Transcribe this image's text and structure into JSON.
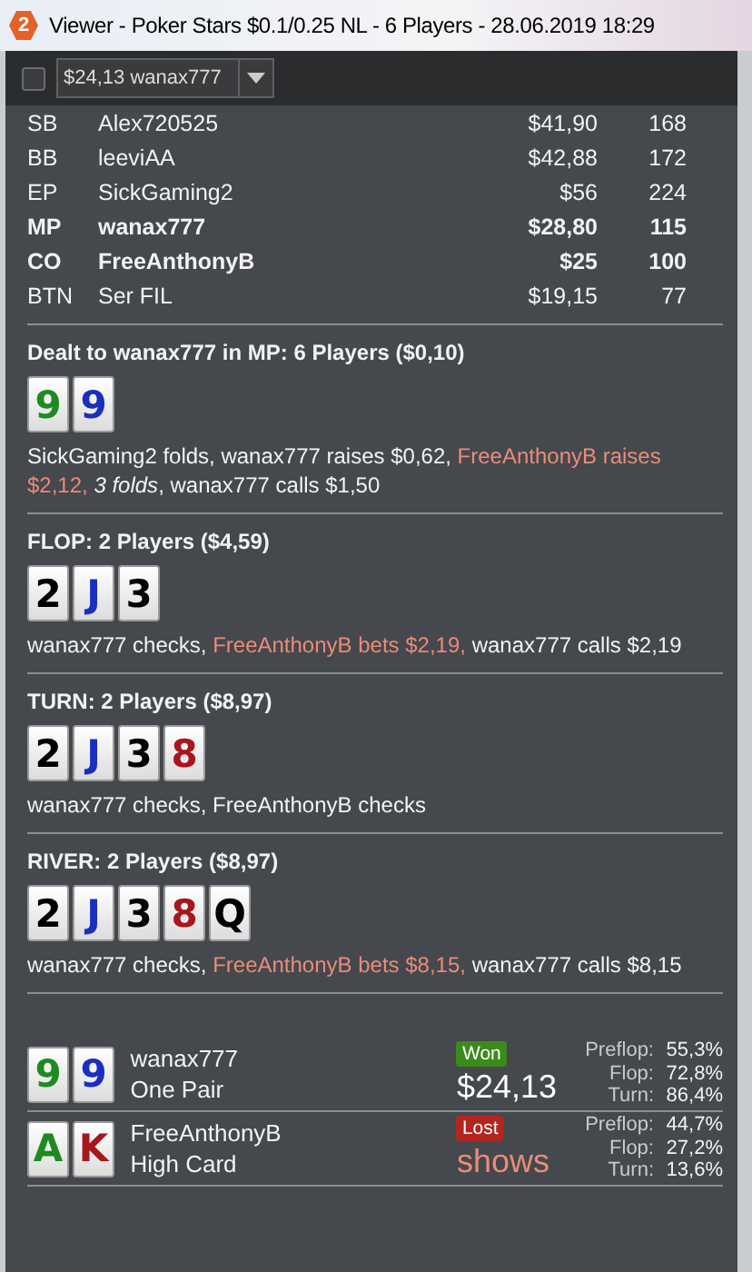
{
  "window": {
    "badge": "2",
    "title": "Viewer - Poker Stars $0.1/0.25 NL - 6 Players - 28.06.2019 18:29"
  },
  "toolbar": {
    "checked": false,
    "hand_select": "$24,13 wanax777"
  },
  "players": [
    {
      "position": "SB",
      "name": "Alex720525",
      "stack": "$41,90",
      "bb": "168",
      "highlight": false
    },
    {
      "position": "BB",
      "name": "leeviAA",
      "stack": "$42,88",
      "bb": "172",
      "highlight": false
    },
    {
      "position": "EP",
      "name": "SickGaming2",
      "stack": "$56",
      "bb": "224",
      "highlight": false
    },
    {
      "position": "MP",
      "name": "wanax777",
      "stack": "$28,80",
      "bb": "115",
      "highlight": true
    },
    {
      "position": "CO",
      "name": "FreeAnthonyB",
      "stack": "$25",
      "bb": "100",
      "highlight": true
    },
    {
      "position": "BTN",
      "name": "Ser FIL",
      "stack": "$19,15",
      "bb": "77",
      "highlight": false
    }
  ],
  "streets": [
    {
      "heading": "Dealt to wanax777 in MP: 6 Players ($0,10)",
      "cards": [
        {
          "rank": "9",
          "color": "#1f8a1f"
        },
        {
          "rank": "9",
          "color": "#1a2fc0"
        }
      ],
      "actions": [
        {
          "kind": "plain",
          "text": "SickGaming2 folds, wanax777 raises $0,62, "
        },
        {
          "kind": "villain",
          "text": "FreeAnthonyB raises $2,12, "
        },
        {
          "kind": "folds",
          "text": "3 folds"
        },
        {
          "kind": "plain",
          "text": ", wanax777 calls $1,50"
        }
      ]
    },
    {
      "heading": "FLOP: 2 Players ($4,59)",
      "cards": [
        {
          "rank": "2",
          "color": "#000000"
        },
        {
          "rank": "J",
          "color": "#1a2fc0"
        },
        {
          "rank": "3",
          "color": "#000000"
        }
      ],
      "actions": [
        {
          "kind": "plain",
          "text": "wanax777 checks, "
        },
        {
          "kind": "villain",
          "text": "FreeAnthonyB bets $2,19,"
        },
        {
          "kind": "plain",
          "text": " wanax777 calls $2,19"
        }
      ]
    },
    {
      "heading": "TURN: 2 Players ($8,97)",
      "cards": [
        {
          "rank": "2",
          "color": "#000000"
        },
        {
          "rank": "J",
          "color": "#1a2fc0"
        },
        {
          "rank": "3",
          "color": "#000000"
        },
        {
          "rank": "8",
          "color": "#a8161c"
        }
      ],
      "actions": [
        {
          "kind": "plain",
          "text": "wanax777 checks, FreeAnthonyB checks"
        }
      ]
    },
    {
      "heading": "RIVER: 2 Players ($8,97)",
      "cards": [
        {
          "rank": "2",
          "color": "#000000"
        },
        {
          "rank": "J",
          "color": "#1a2fc0"
        },
        {
          "rank": "3",
          "color": "#000000"
        },
        {
          "rank": "8",
          "color": "#a8161c"
        },
        {
          "rank": "Q",
          "color": "#000000"
        }
      ],
      "actions": [
        {
          "kind": "plain",
          "text": "wanax777 checks, "
        },
        {
          "kind": "villain",
          "text": "FreeAnthonyB bets $8,15,"
        },
        {
          "kind": "plain",
          "text": " wanax777 calls $8,15"
        }
      ]
    }
  ],
  "results": [
    {
      "cards": [
        {
          "rank": "9",
          "color": "#1f8a1f"
        },
        {
          "rank": "9",
          "color": "#1a2fc0"
        }
      ],
      "name": "wanax777",
      "hand": "One Pair",
      "kind": "won",
      "badge": "Won",
      "amount": "$24,13",
      "equity": [
        {
          "label": "Preflop:",
          "value": "55,3%"
        },
        {
          "label": "Flop:",
          "value": "72,8%"
        },
        {
          "label": "Turn:",
          "value": "86,4%"
        }
      ]
    },
    {
      "cards": [
        {
          "rank": "A",
          "color": "#1f8a1f"
        },
        {
          "rank": "K",
          "color": "#a8161c"
        }
      ],
      "name": "FreeAnthonyB",
      "hand": "High Card",
      "kind": "lost",
      "badge": "Lost",
      "amount": "shows",
      "equity": [
        {
          "label": "Preflop:",
          "value": "44,7%"
        },
        {
          "label": "Flop:",
          "value": "27,2%"
        },
        {
          "label": "Turn:",
          "value": "13,6%"
        }
      ]
    }
  ]
}
